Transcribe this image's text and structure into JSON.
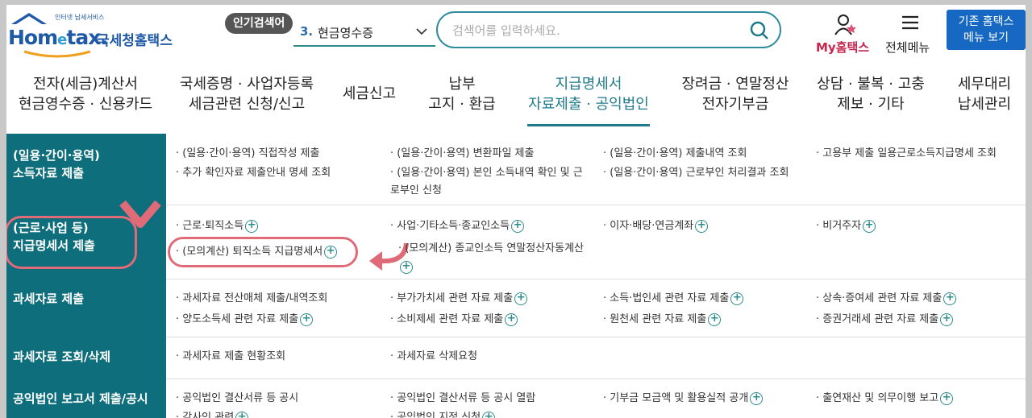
{
  "header": {
    "logo": {
      "small_text": "인터넷 납세서비스",
      "brand_a": "Hom",
      "brand_e": "e",
      "brand_b": "tax.",
      "kr": "국세청홈택스"
    },
    "hot_badge": "인기검색어",
    "hot_select": {
      "rank": "3.",
      "value": "현금영수증"
    },
    "search": {
      "placeholder": "검색어를 입력하세요."
    },
    "my_hometax": "My홈택스",
    "all_menu": "전체메뉴",
    "old_button": {
      "line1": "기존 홈택스",
      "line2": "메뉴 보기"
    }
  },
  "nav": [
    {
      "l1": "전자(세금)계산서",
      "l2": "현금영수증 · 신용카드"
    },
    {
      "l1": "국세증명 · 사업자등록",
      "l2": "세금관련 신청/신고"
    },
    {
      "l1": "세금신고",
      "l2": ""
    },
    {
      "l1": "납부",
      "l2": "고지 · 환급"
    },
    {
      "l1": "지급명세서",
      "l2": "자료제출 · 공익법인"
    },
    {
      "l1": "장려금 · 연말정산",
      "l2": "전자기부금"
    },
    {
      "l1": "상담 · 불복 · 고충",
      "l2": "제보 · 기타"
    },
    {
      "l1": "세무대리",
      "l2": "납세관리"
    }
  ],
  "sections": [
    {
      "label_1": "(일용·간이·용역)",
      "label_2": "소득자료 제출",
      "links": [
        "· (일용·간이·용역) 직접작성 제출",
        "· 추가 확인자료 제출안내 명세 조회",
        "· (일용·간이·용역) 변환파일 제출",
        "· (일용·간이·용역) 본인 소득내역 확인 및 근로부인 신청",
        "· (일용·간이·용역) 제출내역 조회",
        "· (일용·간이·용역) 근로부인 처리결과 조회",
        "· 고용부 제출 일용근로소득지급명세 조회"
      ]
    },
    {
      "label_1": "(근로·사업 등)",
      "label_2": "지급명세서 제출",
      "links": [
        "· 근로·퇴직소득",
        "· (모의계산) 퇴직소득 지급명세서",
        "· 사업·기타소득·종교인소득",
        "· (모의계산) 종교인소득 연말정산자동계산",
        "· 이자·배당·연금계좌",
        "· 비거주자"
      ]
    },
    {
      "label_1": "과세자료 제출",
      "links": [
        "· 과세자료 전산매체 제출/내역조회",
        "· 양도소득세 관련 자료 제출",
        "· 부가가치세 관련 자료 제출",
        "· 소비제세 관련 자료 제출",
        "· 소득·법인세 관련 자료 제출",
        "· 원천세 관련 자료 제출",
        "· 상속·증여세 관련 자료 제출",
        "· 증권거래세 관련 자료 제출"
      ]
    },
    {
      "label_1": "과세자료 조회/삭제",
      "links": [
        "· 과세자료 제출 현황조회",
        "· 과세자료 삭제요청"
      ]
    },
    {
      "label_1": "공익법인 보고서 제출/공시",
      "links": [
        "· 공익법인 결산서류 등 공시",
        "· 공익법인 결산서류 등 공시 열람",
        "· 기부금 모금액 및 활용실적 공개",
        "· 출연재산 및 의무이행 보고",
        "· 감사인 관련",
        "· 공익법인 지정 신청"
      ]
    }
  ],
  "colors": {
    "accent": "#0e6e7b",
    "highlight": "#e06b78",
    "button": "#1668c2"
  }
}
